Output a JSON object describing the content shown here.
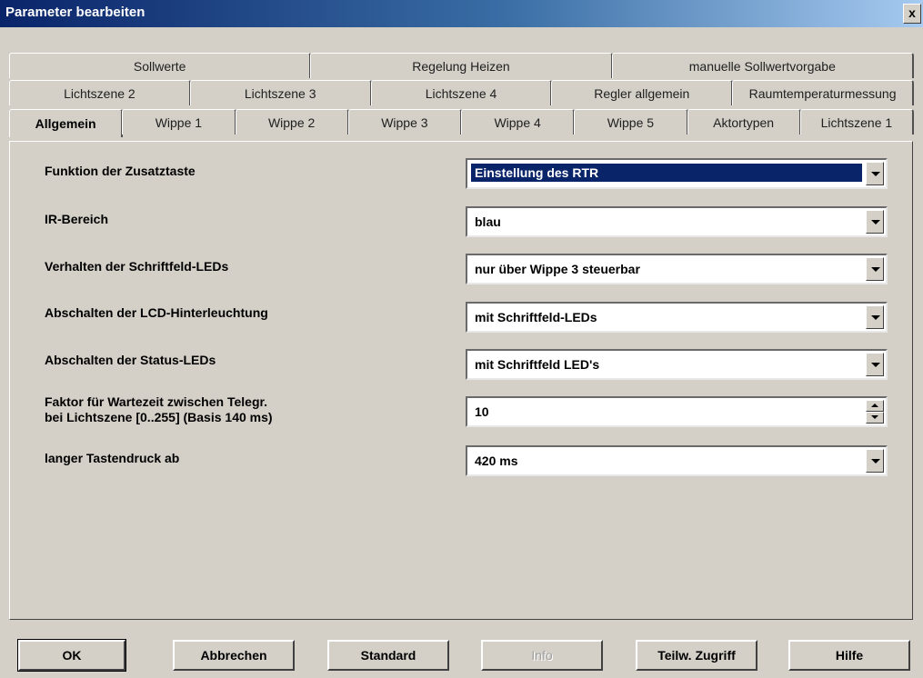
{
  "window": {
    "title": "Parameter bearbeiten",
    "close_glyph": "x"
  },
  "tabs": {
    "row1": [
      "Sollwerte",
      "Regelung Heizen",
      "manuelle Sollwertvorgabe"
    ],
    "row2": [
      "Lichtszene 2",
      "Lichtszene 3",
      "Lichtszene 4",
      "Regler allgemein",
      "Raumtemperaturmessung"
    ],
    "row3": [
      "Allgemein",
      "Wippe 1",
      "Wippe 2",
      "Wippe 3",
      "Wippe 4",
      "Wippe 5",
      "Aktortypen",
      "Lichtszene 1"
    ],
    "active": "Allgemein"
  },
  "params": [
    {
      "label": "Funktion der Zusatztaste",
      "value": "Einstellung des RTR",
      "control": "dropdown",
      "selected": true
    },
    {
      "label": "IR-Bereich",
      "value": "blau",
      "control": "dropdown"
    },
    {
      "label": "Verhalten der Schriftfeld-LEDs",
      "value": "nur über Wippe 3 steuerbar",
      "control": "dropdown"
    },
    {
      "label": "Abschalten der LCD-Hinterleuchtung",
      "value": "mit Schriftfeld-LEDs",
      "control": "dropdown"
    },
    {
      "label": "Abschalten der Status-LEDs",
      "value": "mit Schriftfeld LED's",
      "control": "dropdown"
    },
    {
      "label_line1": "Faktor für Wartezeit zwischen Telegr.",
      "label_line2": "bei Lichtszene [0..255] (Basis 140 ms)",
      "value": "10",
      "control": "spinner"
    },
    {
      "label": "langer Tastendruck ab",
      "value": "420 ms",
      "control": "dropdown"
    }
  ],
  "buttons": {
    "ok": "OK",
    "cancel": "Abbrechen",
    "standard": "Standard",
    "info": "Info",
    "partial_access": "Teilw. Zugriff",
    "help": "Hilfe"
  },
  "colors": {
    "titlebar": "#0a246a",
    "selection": "#0a246a",
    "face": "#d4d0c8"
  }
}
